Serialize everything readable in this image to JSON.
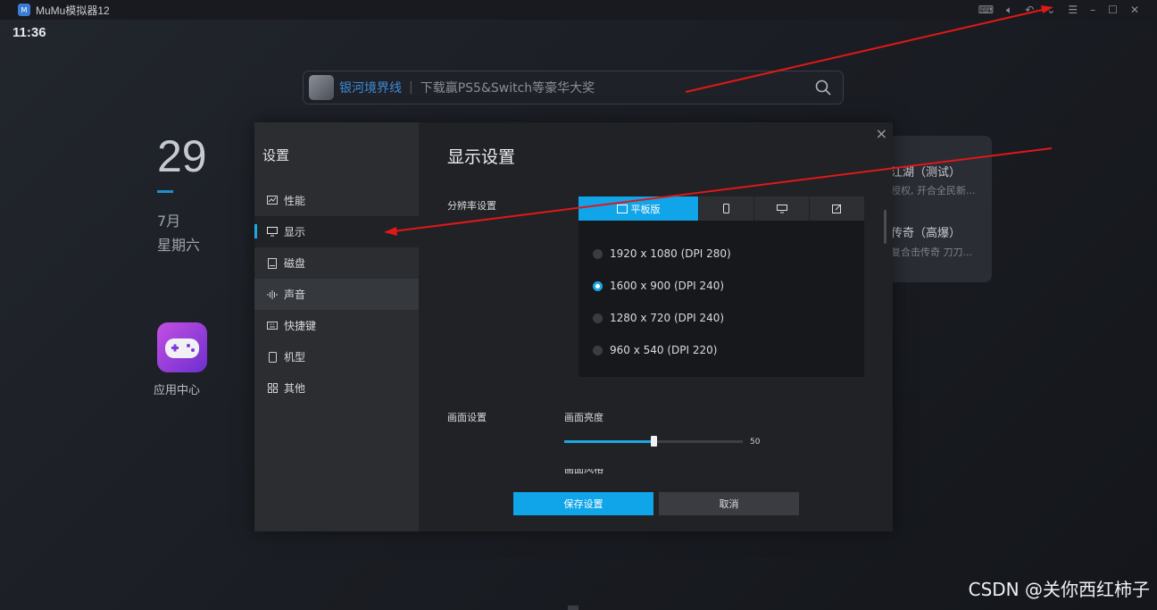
{
  "window": {
    "title": "MuMu模拟器12",
    "logo_text": "M"
  },
  "status": {
    "time": "11:36"
  },
  "search": {
    "game_name": "银河境界线",
    "separator": "|",
    "promo": "下载赢PS5&Switch等豪华大奖"
  },
  "date": {
    "day": "29",
    "month": "7月",
    "weekday": "星期六"
  },
  "desktop_app": {
    "label": "应用中心"
  },
  "right_card": {
    "items": [
      {
        "title": "江湖（测试）",
        "subtitle": "授权, 开合全民新..."
      },
      {
        "title": "传奇（高爆）",
        "subtitle": "复合击传奇 刀刀..."
      }
    ]
  },
  "settings": {
    "title": "设置",
    "nav": [
      {
        "label": "性能",
        "icon": "chart-icon"
      },
      {
        "label": "显示",
        "icon": "monitor-icon"
      },
      {
        "label": "磁盘",
        "icon": "disk-icon"
      },
      {
        "label": "声音",
        "icon": "sound-icon"
      },
      {
        "label": "快捷键",
        "icon": "keyboard-icon"
      },
      {
        "label": "机型",
        "icon": "phone-icon"
      },
      {
        "label": "其他",
        "icon": "grid-icon"
      }
    ],
    "active_nav": "显示",
    "page_title": "显示设置",
    "resolution_label": "分辨率设置",
    "tabs": [
      {
        "label": "平板版",
        "icon": "tablet-icon"
      },
      {
        "label": "",
        "icon": "phone-icon"
      },
      {
        "label": "",
        "icon": "monitor-icon"
      },
      {
        "label": "",
        "icon": "edit-icon"
      }
    ],
    "resolutions": [
      "1920 x 1080 (DPI 280)",
      "1600 x 900 (DPI 240)",
      "1280 x 720 (DPI 240)",
      "960 x 540 (DPI 220)"
    ],
    "selected_resolution": "1600 x 900 (DPI 240)",
    "picture_label": "画面设置",
    "brightness_label": "画面亮度",
    "brightness_value": "50",
    "brightness_fraction": 0.5,
    "next_label_cut": "画面风格",
    "save_label": "保存设置",
    "cancel_label": "取消",
    "close_symbol": "×"
  },
  "colors": {
    "accent": "#10a4e8",
    "arrow": "#e01818"
  },
  "watermark": "CSDN @关你西红柿子"
}
